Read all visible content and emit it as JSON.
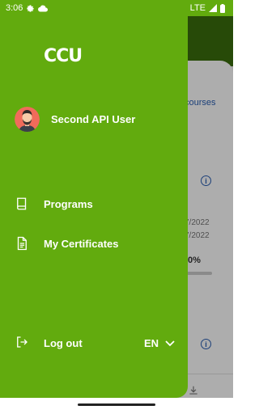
{
  "status_bar": {
    "time": "3:06",
    "network": "LTE",
    "icons": [
      "settings-icon",
      "cloud-icon",
      "signal-icon",
      "battery-icon"
    ]
  },
  "background": {
    "courses_link": "courses",
    "date_1": "7/2022",
    "date_2": "7/2022",
    "progress_text": "0%",
    "nav_downloads": "wnloads"
  },
  "drawer": {
    "logo": "CCU",
    "user_name": "Second API User",
    "menu": [
      {
        "label": "Programs",
        "icon": "book-icon"
      },
      {
        "label": "My Certificates",
        "icon": "document-icon"
      }
    ],
    "logout_label": "Log out",
    "language": "EN"
  },
  "colors": {
    "drawer": "#62ab0e",
    "header_dark": "#3a6e0c",
    "link": "#2a5fb3"
  }
}
